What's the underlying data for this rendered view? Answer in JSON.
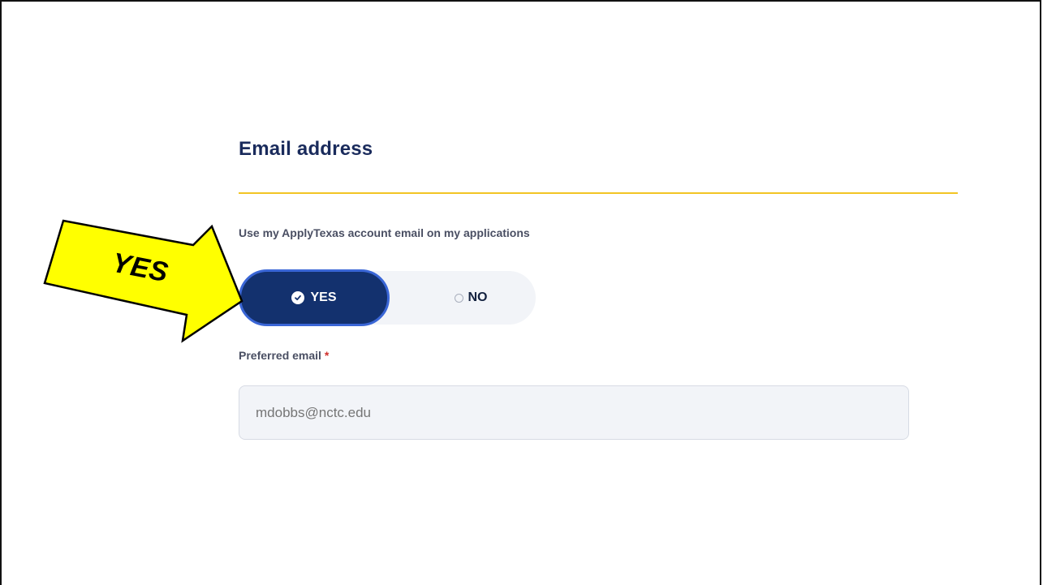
{
  "section": {
    "title": "Email address"
  },
  "question": {
    "text": "Use my ApplyTexas account email on my applications"
  },
  "toggle": {
    "yes_label": "YES",
    "no_label": "NO",
    "selected": "YES"
  },
  "preferred_email": {
    "label": "Preferred email",
    "required_marker": "*",
    "placeholder": "mdobbs@nctc.edu"
  },
  "annotation": {
    "callout_text": "YES"
  },
  "colors": {
    "title": "#1a2b5c",
    "divider": "#f2c424",
    "toggle_selected": "#13316e",
    "callout_fill": "#ffff00",
    "required": "#d0312d"
  }
}
